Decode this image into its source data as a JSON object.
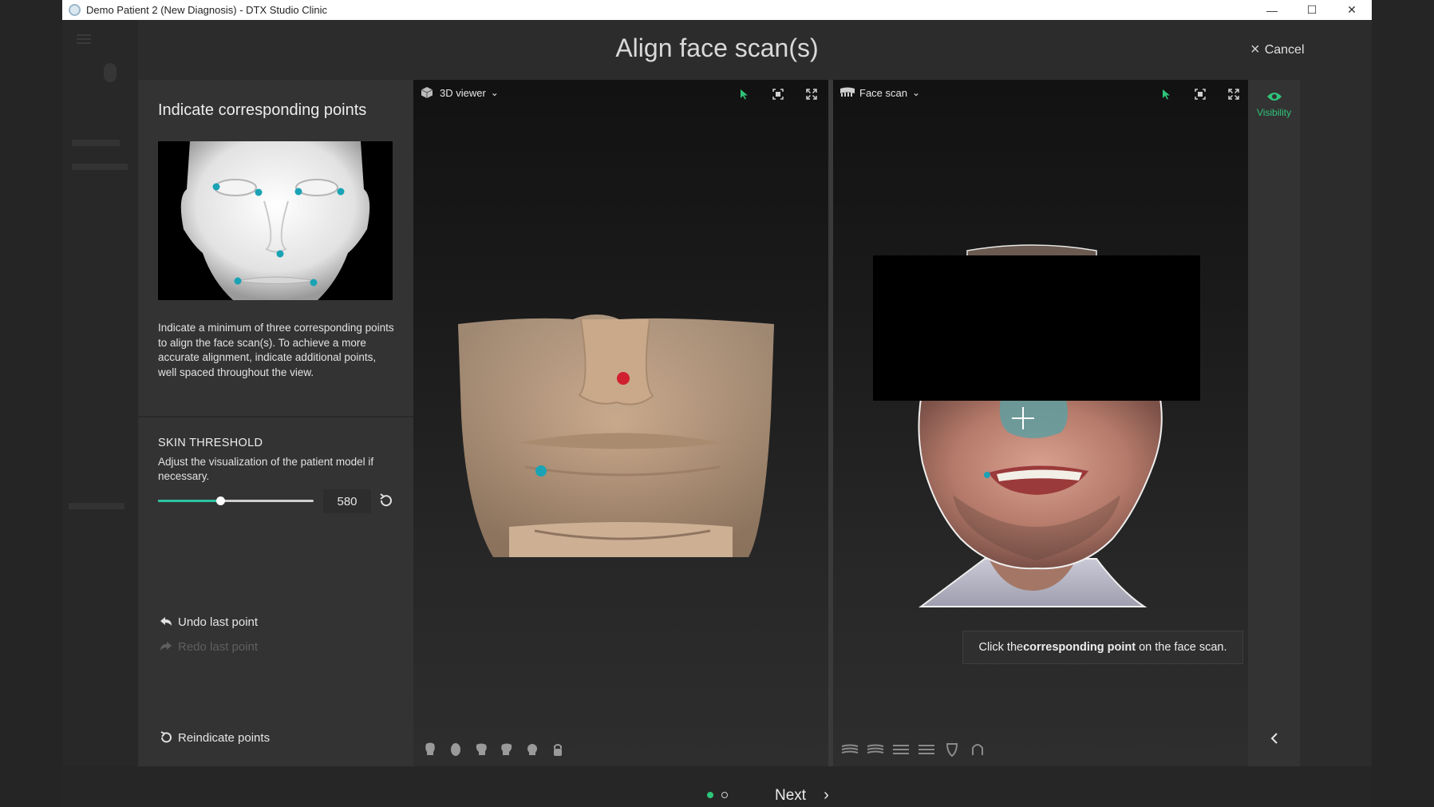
{
  "window": {
    "title": "Demo Patient 2 (New Diagnosis) - DTX Studio Clinic",
    "controls": {
      "minimize": "—",
      "maximize": "☐",
      "close": "✕"
    }
  },
  "dialog": {
    "title": "Align face scan(s)",
    "cancel_label": "Cancel"
  },
  "left_panel": {
    "heading": "Indicate corresponding points",
    "description": "Indicate a minimum of three corresponding points to align the face scan(s). To achieve a more accurate alignment, indicate additional points, well spaced throughout the view.",
    "skin_threshold": {
      "title": "SKIN THRESHOLD",
      "description": "Adjust the visualization of the patient model if necessary.",
      "value": "580",
      "slider_fraction": 0.4
    },
    "undo_label": "Undo last point",
    "redo_label": "Redo last point",
    "reindicate_label": "Reindicate points"
  },
  "viewer_3d": {
    "label": "3D viewer"
  },
  "viewer_face": {
    "label": "Face scan",
    "hint_prefix": "Click the ",
    "hint_bold": "corresponding point",
    "hint_suffix": " on the face scan."
  },
  "tools": {
    "visibility_label": "Visibility"
  },
  "footer": {
    "next_label": "Next",
    "pages_total": 2,
    "page_current": 1
  },
  "colors": {
    "accent_green": "#2ec47a",
    "point_teal": "#1aa3b5",
    "point_red": "#d0202f",
    "skin_model": "#c9a98a"
  }
}
